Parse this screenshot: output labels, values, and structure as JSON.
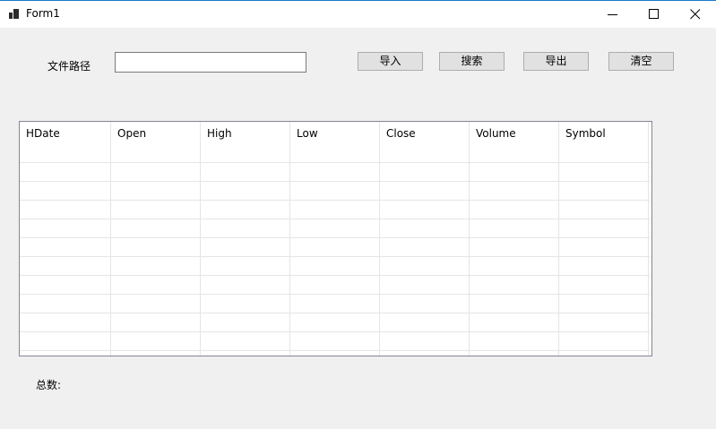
{
  "window": {
    "title": "Form1"
  },
  "form": {
    "path_label": "文件路径",
    "path_value": "",
    "buttons": {
      "import": "导入",
      "search": "搜索",
      "export": "导出",
      "clear": "清空"
    },
    "count_label": "总数:",
    "count_value": ""
  },
  "table": {
    "columns": [
      "HDate",
      "Open",
      "High",
      "Low",
      "Close",
      "Volume",
      "Symbol"
    ],
    "rows": []
  }
}
